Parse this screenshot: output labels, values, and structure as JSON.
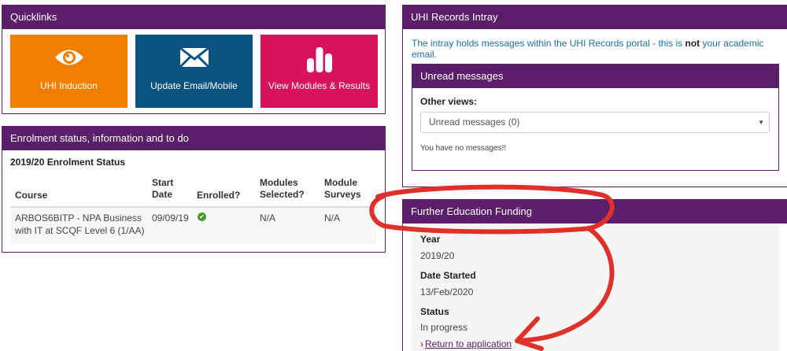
{
  "quicklinks": {
    "title": "Quicklinks",
    "tiles": [
      {
        "label": "UHI Induction",
        "icon": "eye-icon",
        "color": "#f07f00"
      },
      {
        "label": "Update Email/Mobile",
        "icon": "envelope-icon",
        "color": "#0a5280"
      },
      {
        "label": "View Modules & Results",
        "icon": "bar-chart-icon",
        "color": "#d9125c"
      }
    ]
  },
  "enrolment": {
    "title": "Enrolment status, information and to do",
    "subtitle": "2019/20 Enrolment Status",
    "headers": {
      "course": "Course",
      "start_date_1": "Start",
      "start_date_2": "Date",
      "enrolled": "Enrolled?",
      "modules_1": "Modules",
      "modules_2": "Selected?",
      "surveys_1": "Module",
      "surveys_2": "Surveys"
    },
    "rows": [
      {
        "course_1": "ARBOS6BITP - NPA Business",
        "course_2": "with IT at SCQF Level 6 (1/AA)",
        "start_date": "09/09/19",
        "enrolled_icon": "check-circle-icon",
        "modules_selected": "N/A",
        "module_surveys": "N/A"
      }
    ]
  },
  "intray": {
    "title": "UHI Records Intray",
    "info_pre": "The intray holds messages within the UHI Records portal - this is ",
    "info_bold": "not",
    "info_post": " your academic email.",
    "unread": {
      "title": "Unread messages",
      "other_views_label": "Other views:",
      "selected_view": "Unread messages (0)",
      "empty_text": "You have no messages!!"
    }
  },
  "funding": {
    "title": "Further Education Funding",
    "year_label": "Year",
    "year_value": "2019/20",
    "date_label": "Date Started",
    "date_value": "13/Feb/2020",
    "status_label": "Status",
    "status_value": "In progress",
    "return_link": "Return to application"
  },
  "colors": {
    "panel_header": "#5b1f69",
    "annotation": "#e0302a"
  }
}
